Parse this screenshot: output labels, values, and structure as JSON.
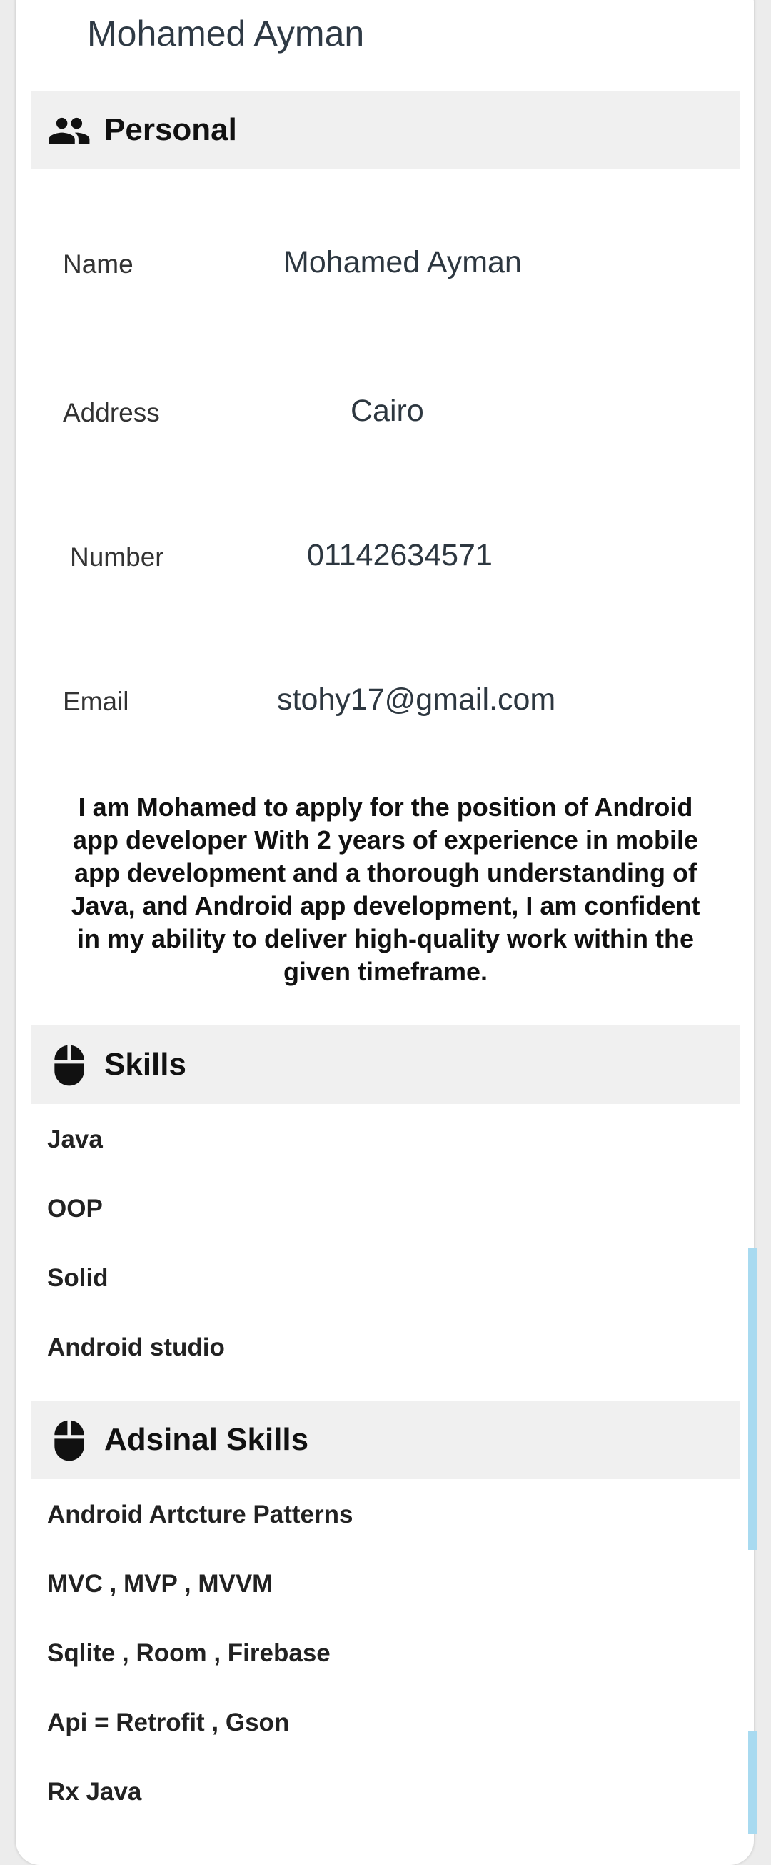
{
  "profile": {
    "header_name": "Mohamed Ayman"
  },
  "personal": {
    "title": "Personal",
    "icon": "people-icon",
    "fields": {
      "name": {
        "label": "Name",
        "value": "Mohamed Ayman"
      },
      "address": {
        "label": "Address",
        "value": "Cairo"
      },
      "number": {
        "label": "Number",
        "value": "01142634571"
      },
      "email": {
        "label": "Email",
        "value": "stohy17@gmail.com"
      }
    },
    "summary": "I am Mohamed to apply for the position of Android app developer With 2 years of experience in mobile app development and a thorough understanding of Java,  and Android app development, I am confident in my ability to deliver high-quality work within the given timeframe."
  },
  "skills": {
    "title": "Skills",
    "icon": "mouse-icon",
    "items": [
      "Java",
      "OOP",
      "Solid",
      "Android studio"
    ]
  },
  "additional_skills": {
    "title": "Adsinal Skills",
    "icon": "mouse-icon",
    "items": [
      "Android Artcture Patterns",
      "MVC , MVP , MVVM",
      "Sqlite , Room , Firebase",
      "Api = Retrofit , Gson",
      "Rx Java"
    ]
  },
  "colors": {
    "section_bg": "#f0f0f0",
    "scrollbar": "#a8daf0"
  }
}
